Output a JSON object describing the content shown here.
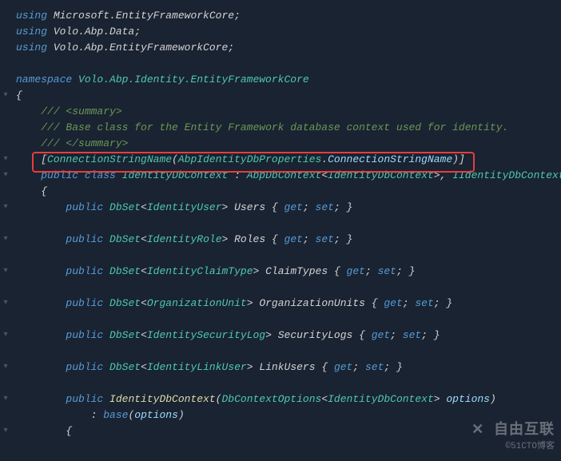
{
  "code": {
    "l1": {
      "kw": "using",
      "ns": " Microsoft.EntityFrameworkCore;"
    },
    "l2": {
      "kw": "using",
      "ns": " Volo.Abp.Data;"
    },
    "l3": {
      "kw": "using",
      "ns": " Volo.Abp.EntityFrameworkCore;"
    },
    "l4": {
      "kw": "namespace",
      "ns": " Volo.Abp.Identity.EntityFrameworkCore"
    },
    "l5": "{",
    "c1": "/// <summary>",
    "c2": "/// Base class for the Entity Framework database context used for identity.",
    "c3": "/// </summary>",
    "attr": {
      "open": "[",
      "a": "ConnectionStringName",
      "paren": "(",
      "b": "AbpIdentityDbProperties",
      "dot": ".",
      "c": "ConnectionStringName",
      "close": ")]"
    },
    "cls": {
      "pub": "public",
      "cl": "class",
      "name": "IdentityDbContext",
      "colon": " : ",
      "base": "AbpDbContext",
      "lt": "<",
      "t1": "IdentityDbContext",
      "gt": ">",
      "comma": ", ",
      "iface": "IIdentityDbContext"
    },
    "ob": "{",
    "p1": {
      "pub": "public",
      "ds": "DbSet",
      "lt": "<",
      "t": "IdentityUser",
      "gt": ">",
      "name": " Users ",
      "ob": "{ ",
      "get": "get",
      "s1": "; ",
      "set": "set",
      "s2": "; }"
    },
    "p2": {
      "pub": "public",
      "ds": "DbSet",
      "lt": "<",
      "t": "IdentityRole",
      "gt": ">",
      "name": " Roles ",
      "ob": "{ ",
      "get": "get",
      "s1": "; ",
      "set": "set",
      "s2": "; }"
    },
    "p3": {
      "pub": "public",
      "ds": "DbSet",
      "lt": "<",
      "t": "IdentityClaimType",
      "gt": ">",
      "name": " ClaimTypes ",
      "ob": "{ ",
      "get": "get",
      "s1": "; ",
      "set": "set",
      "s2": "; }"
    },
    "p4": {
      "pub": "public",
      "ds": "DbSet",
      "lt": "<",
      "t": "OrganizationUnit",
      "gt": ">",
      "name": " OrganizationUnits ",
      "ob": "{ ",
      "get": "get",
      "s1": "; ",
      "set": "set",
      "s2": "; }"
    },
    "p5": {
      "pub": "public",
      "ds": "DbSet",
      "lt": "<",
      "t": "IdentitySecurityLog",
      "gt": ">",
      "name": " SecurityLogs ",
      "ob": "{ ",
      "get": "get",
      "s1": "; ",
      "set": "set",
      "s2": "; }"
    },
    "p6": {
      "pub": "public",
      "ds": "DbSet",
      "lt": "<",
      "t": "IdentityLinkUser",
      "gt": ">",
      "name": " LinkUsers ",
      "ob": "{ ",
      "get": "get",
      "s1": "; ",
      "set": "set",
      "s2": "; }"
    },
    "ctor": {
      "pub": "public",
      "name": " IdentityDbContext",
      "op": "(",
      "pt": "DbContextOptions",
      "lt": "<",
      "t": "IdentityDbContext",
      "gt": ">",
      "pn": " options",
      "cp": ")"
    },
    "base": {
      "colon": ": ",
      "b": "base",
      "op": "(",
      "arg": "options",
      "cp": ")"
    },
    "ob2": "{"
  },
  "fold_marker": "▾",
  "watermark": {
    "logo": "✕ 自由互联",
    "sub": "©51CTO博客"
  }
}
